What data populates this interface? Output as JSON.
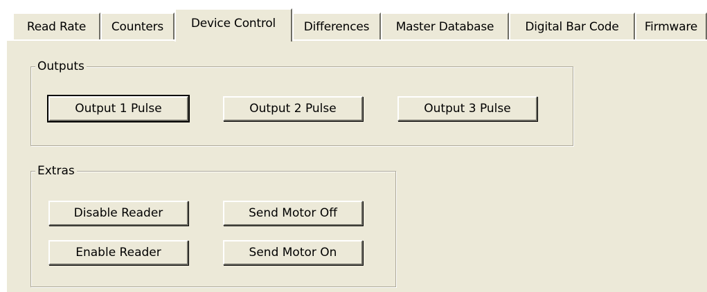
{
  "tabs": [
    {
      "label": "Read Rate",
      "active": false
    },
    {
      "label": "Counters",
      "active": false
    },
    {
      "label": "Device Control",
      "active": true
    },
    {
      "label": "Differences",
      "active": false
    },
    {
      "label": "Master Database",
      "active": false
    },
    {
      "label": "Digital Bar Code",
      "active": false
    },
    {
      "label": "Firmware",
      "active": false
    }
  ],
  "outputs": {
    "title": "Outputs",
    "buttons": [
      {
        "label": "Output 1 Pulse",
        "default": true
      },
      {
        "label": "Output 2 Pulse",
        "default": false
      },
      {
        "label": "Output 3 Pulse",
        "default": false
      }
    ]
  },
  "extras": {
    "title": "Extras",
    "disable_reader": "Disable Reader",
    "send_motor_off": "Send Motor Off",
    "enable_reader": "Enable Reader",
    "send_motor_on": "Send Motor On"
  }
}
